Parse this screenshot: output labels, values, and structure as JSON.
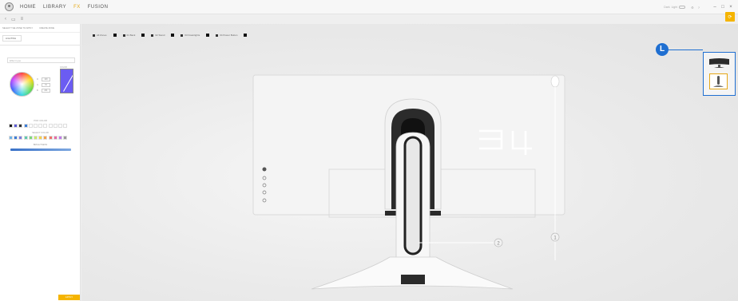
{
  "nav": {
    "items": [
      {
        "label": "HOME",
        "active": false
      },
      {
        "label": "LIBRARY",
        "active": false
      },
      {
        "label": "FX",
        "active": true
      },
      {
        "label": "FUSION",
        "active": false
      }
    ],
    "theme_dark": "Dark",
    "theme_light": "Light",
    "accent_color": "#e6a817"
  },
  "sidebar": {
    "actions": [
      "SELECT THE ZONE TO APPLY",
      "CREATE ZONE"
    ],
    "tab_label": "LIGHTING",
    "effect_value": "Effect type",
    "section_color": "COLOR",
    "inputs": [
      {
        "label": "R",
        "value": "109"
      },
      {
        "label": "G",
        "value": "91"
      },
      {
        "label": "B",
        "value": "241"
      }
    ],
    "section_pick": "PICK COLOR",
    "section_saved": "SELECT COLOR",
    "section_brightness": "BRIGHTNESS",
    "pick_swatches": [
      "#1a1a1a",
      "#5b5bd6",
      "#333333",
      "#3b7dd8",
      "#ffffff",
      "#ffffff",
      "#ffffff",
      "#ffffff",
      "#ffffff",
      "#ffffff",
      "#ffffff",
      "#ffffff"
    ],
    "saved_swatches": [
      "#6fb3e8",
      "#3b7dd8",
      "#7e7de0",
      "#5fc9b0",
      "#7dd87a",
      "#c8e86a",
      "#f5d24a",
      "#f5a24a",
      "#f0706a",
      "#e86aa8",
      "#c07ae8",
      "#9a9a9a"
    ],
    "apply_label": "APPLY"
  },
  "zones": [
    {
      "label": "All Zones",
      "color": "#111111"
    },
    {
      "label": "01 Back",
      "color": "#111111"
    },
    {
      "label": "02 Stand",
      "color": "#111111"
    },
    {
      "label": "03 Downlights",
      "color": "#111111"
    },
    {
      "label": "04 Power Button",
      "color": "#111111"
    }
  ],
  "callouts": {
    "c1": "1",
    "c2": "2",
    "highlight": "L",
    "highlight_color": "#1f6fd1"
  }
}
